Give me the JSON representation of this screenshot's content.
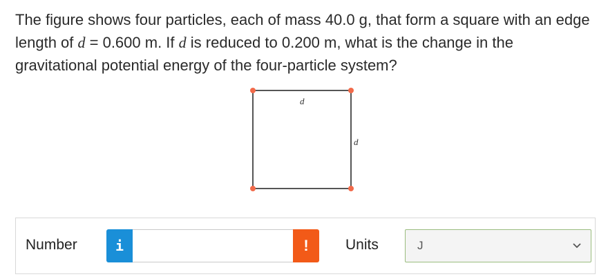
{
  "question": {
    "part1": "The figure shows four particles, each of mass 40.0 g, that form a square with an edge length of ",
    "var1": "d",
    "part2": " = 0.600 m. If ",
    "var2": "d",
    "part3": " is reduced to 0.200 m, what is the change in the gravitational potential energy of the four-particle system?"
  },
  "figure": {
    "top_label": "d",
    "side_label": "d",
    "particle_color": "#f26a4a",
    "edge_color": "#555555"
  },
  "answer": {
    "number_label": "Number",
    "info_icon_glyph": "i",
    "number_value": "",
    "warn_icon_glyph": "!",
    "units_label": "Units",
    "units_selected": "J"
  },
  "colors": {
    "info_blue": "#1a8fd8",
    "warn_orange": "#f25a18",
    "select_border": "#9abd7e"
  }
}
